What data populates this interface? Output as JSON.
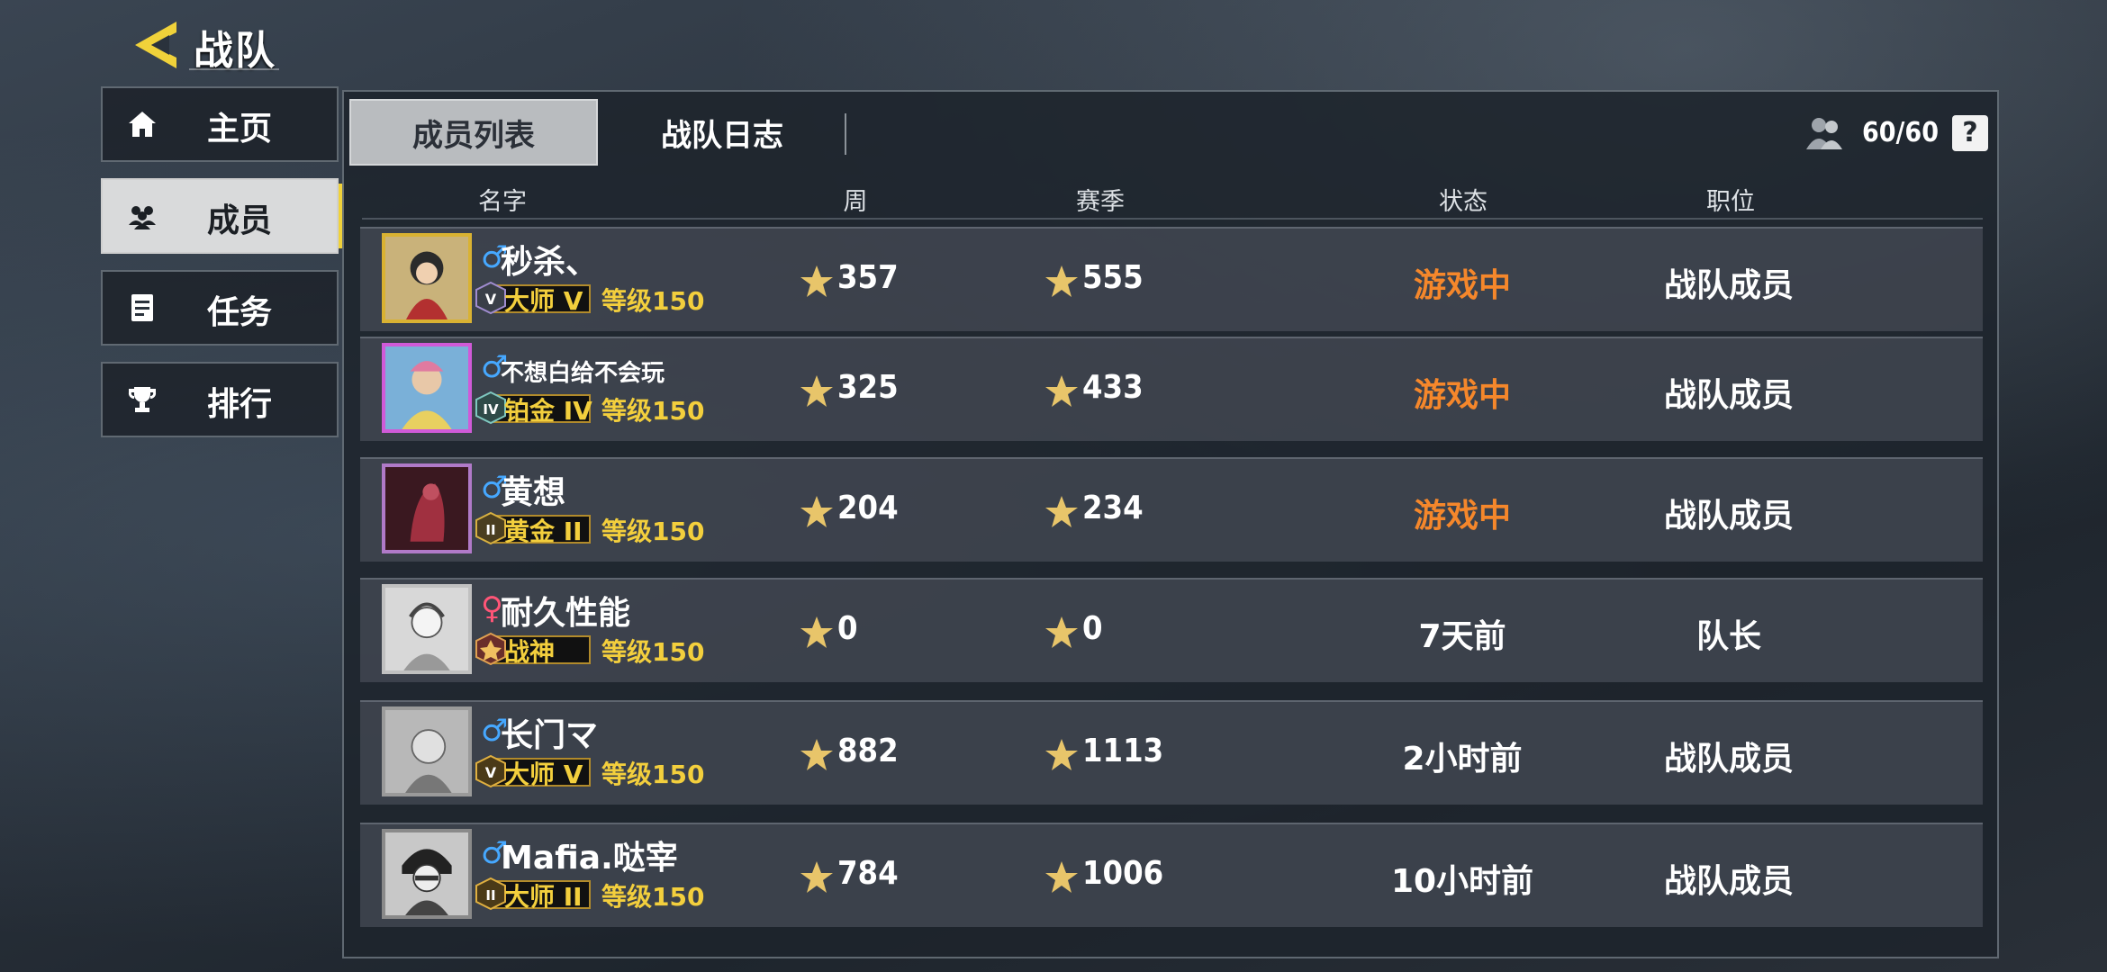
{
  "header": {
    "title": "战队"
  },
  "sidebar": {
    "items": [
      {
        "label": "主页",
        "icon": "home-icon"
      },
      {
        "label": "成员",
        "icon": "members-icon",
        "active": true
      },
      {
        "label": "任务",
        "icon": "tasks-icon"
      },
      {
        "label": "排行",
        "icon": "trophy-icon"
      }
    ]
  },
  "tabs": [
    {
      "label": "成员列表",
      "active": true
    },
    {
      "label": "战队日志",
      "active": false
    }
  ],
  "member_count": "60/60",
  "help_label": "?",
  "columns": [
    "名字",
    "周",
    "赛季",
    "状态",
    "职位"
  ],
  "colors": {
    "accent": "#f3cf3d",
    "ingame": "#f5872b",
    "male": "#46a8ff",
    "female": "#ff5577"
  },
  "members": [
    {
      "gender": "♂",
      "name": "秒杀、",
      "rank": "大师 V",
      "rank_numeral": "V",
      "level": "等级150",
      "week": "357",
      "season": "555",
      "status": "游戏中",
      "position": "战队成员"
    },
    {
      "gender": "♂",
      "name": "不想白给不会玩",
      "rank": "铂金 IV",
      "rank_numeral": "IV",
      "level": "等级150",
      "week": "325",
      "season": "433",
      "status": "游戏中",
      "position": "战队成员"
    },
    {
      "gender": "♂",
      "name": "黄想",
      "rank": "黄金 II",
      "rank_numeral": "II",
      "level": "等级150",
      "week": "204",
      "season": "234",
      "status": "游戏中",
      "position": "战队成员"
    },
    {
      "gender": "♀",
      "name": "耐久性能",
      "rank": "战神",
      "rank_numeral": "",
      "level": "等级150",
      "week": "0",
      "season": "0",
      "status": "7天前",
      "position": "队长"
    },
    {
      "gender": "♂",
      "name": "长门マ",
      "rank": "大师 V",
      "rank_numeral": "V",
      "level": "等级150",
      "week": "882",
      "season": "1113",
      "status": "2小时前",
      "position": "战队成员"
    },
    {
      "gender": "♂",
      "name": "Mafia.哒宰",
      "rank": "大师 II",
      "rank_numeral": "II",
      "level": "等级150",
      "week": "784",
      "season": "1006",
      "status": "10小时前",
      "position": "战队成员"
    }
  ]
}
